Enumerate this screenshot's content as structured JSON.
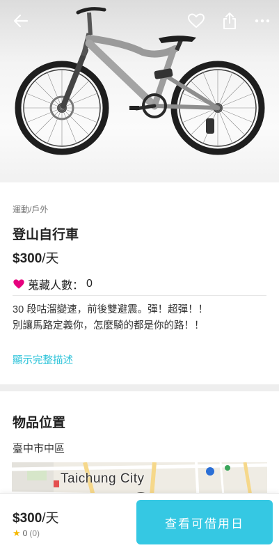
{
  "header": {
    "back_icon": "back-arrow-icon",
    "favorite_icon": "heart-icon",
    "share_icon": "share-icon",
    "more_icon": "more-dots-icon"
  },
  "item": {
    "category": "運動/戶外",
    "title": "登山自行車",
    "price_amount": "$300",
    "price_unit": "/天",
    "favorites_label": "蒐藏人數：",
    "favorites_count": "0",
    "description_line1": "30 段咕溜變速，前後雙避震。彈！超彈！！",
    "description_line2": "別讓馬路定義你，怎麼騎的都是你的路！！",
    "show_full_description": "顯示完整描述"
  },
  "location": {
    "section_title": "物品位置",
    "area": "臺中市中區",
    "map_label": "Taichung City"
  },
  "bottom_bar": {
    "price_amount": "$300",
    "price_unit": "/天",
    "rating": "0",
    "review_count": "(0)",
    "cta_label": "查看可借用日"
  },
  "colors": {
    "accent": "#35c8e3",
    "link": "#2cc3d9",
    "heart": "#e6007e",
    "star": "#f5b800"
  }
}
